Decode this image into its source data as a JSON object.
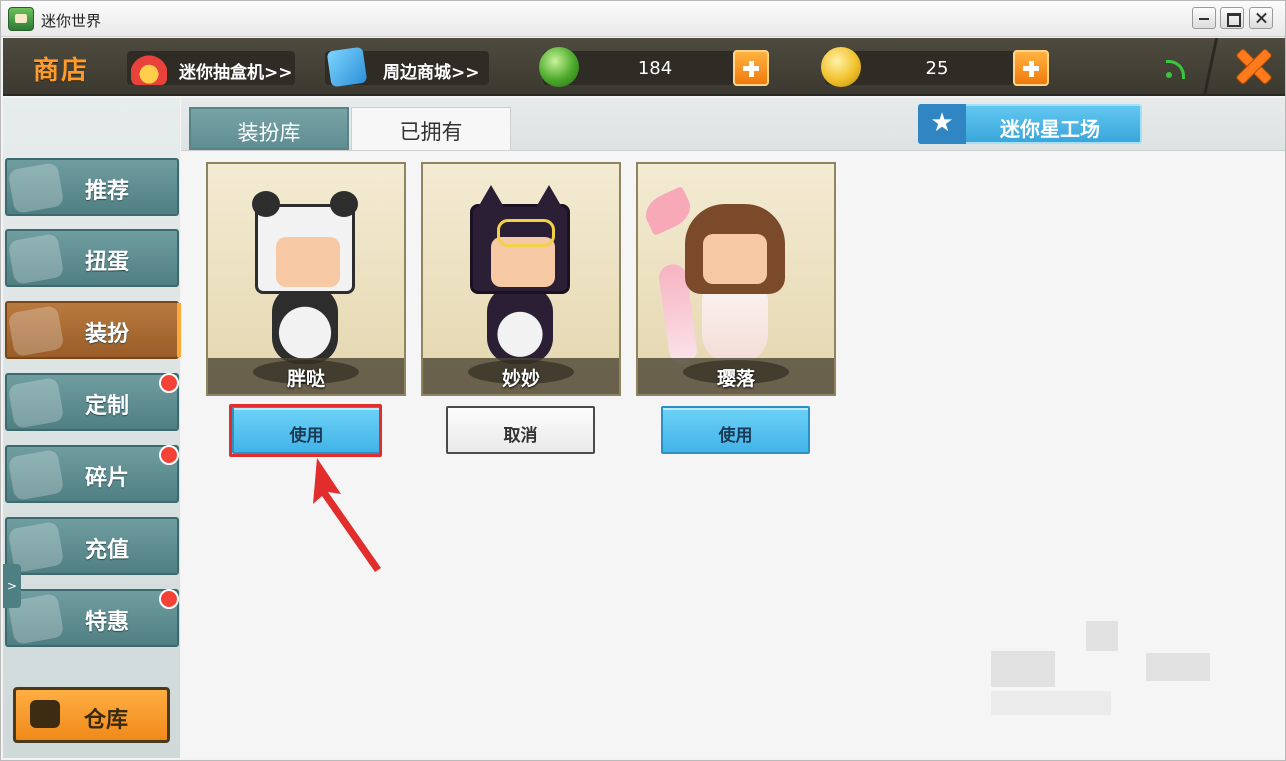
{
  "window": {
    "title": "迷你世界"
  },
  "header": {
    "shop_title": "商店",
    "gacha_label": "迷你抽盒机>>",
    "mall_label": "周边商城>>",
    "gem_count": "184",
    "coin_count": "25"
  },
  "sidebar": {
    "items": [
      {
        "label": "推荐",
        "badge": false
      },
      {
        "label": "扭蛋",
        "badge": false
      },
      {
        "label": "装扮",
        "badge": false,
        "active": true
      },
      {
        "label": "定制",
        "badge": true
      },
      {
        "label": "碎片",
        "badge": true
      },
      {
        "label": "充值",
        "badge": false
      },
      {
        "label": "特惠",
        "badge": true
      }
    ],
    "warehouse_label": "仓库"
  },
  "tabs": [
    {
      "label": "装扮库",
      "active": false
    },
    {
      "label": "已拥有",
      "active": true
    }
  ],
  "studio_button": "迷你星工场",
  "skins": [
    {
      "name": "胖哒",
      "action": "使用",
      "icon": "panda-skin-icon"
    },
    {
      "name": "妙妙",
      "action": "取消",
      "icon": "cat-skin-icon"
    },
    {
      "name": "璎落",
      "action": "使用",
      "icon": "girl-skin-icon"
    }
  ],
  "colors": {
    "accent_orange": "#ff9a2e",
    "use_button_blue": "#42b3e8",
    "highlight_red": "#e22d2d",
    "sidebar_teal": "#5f8e92"
  }
}
